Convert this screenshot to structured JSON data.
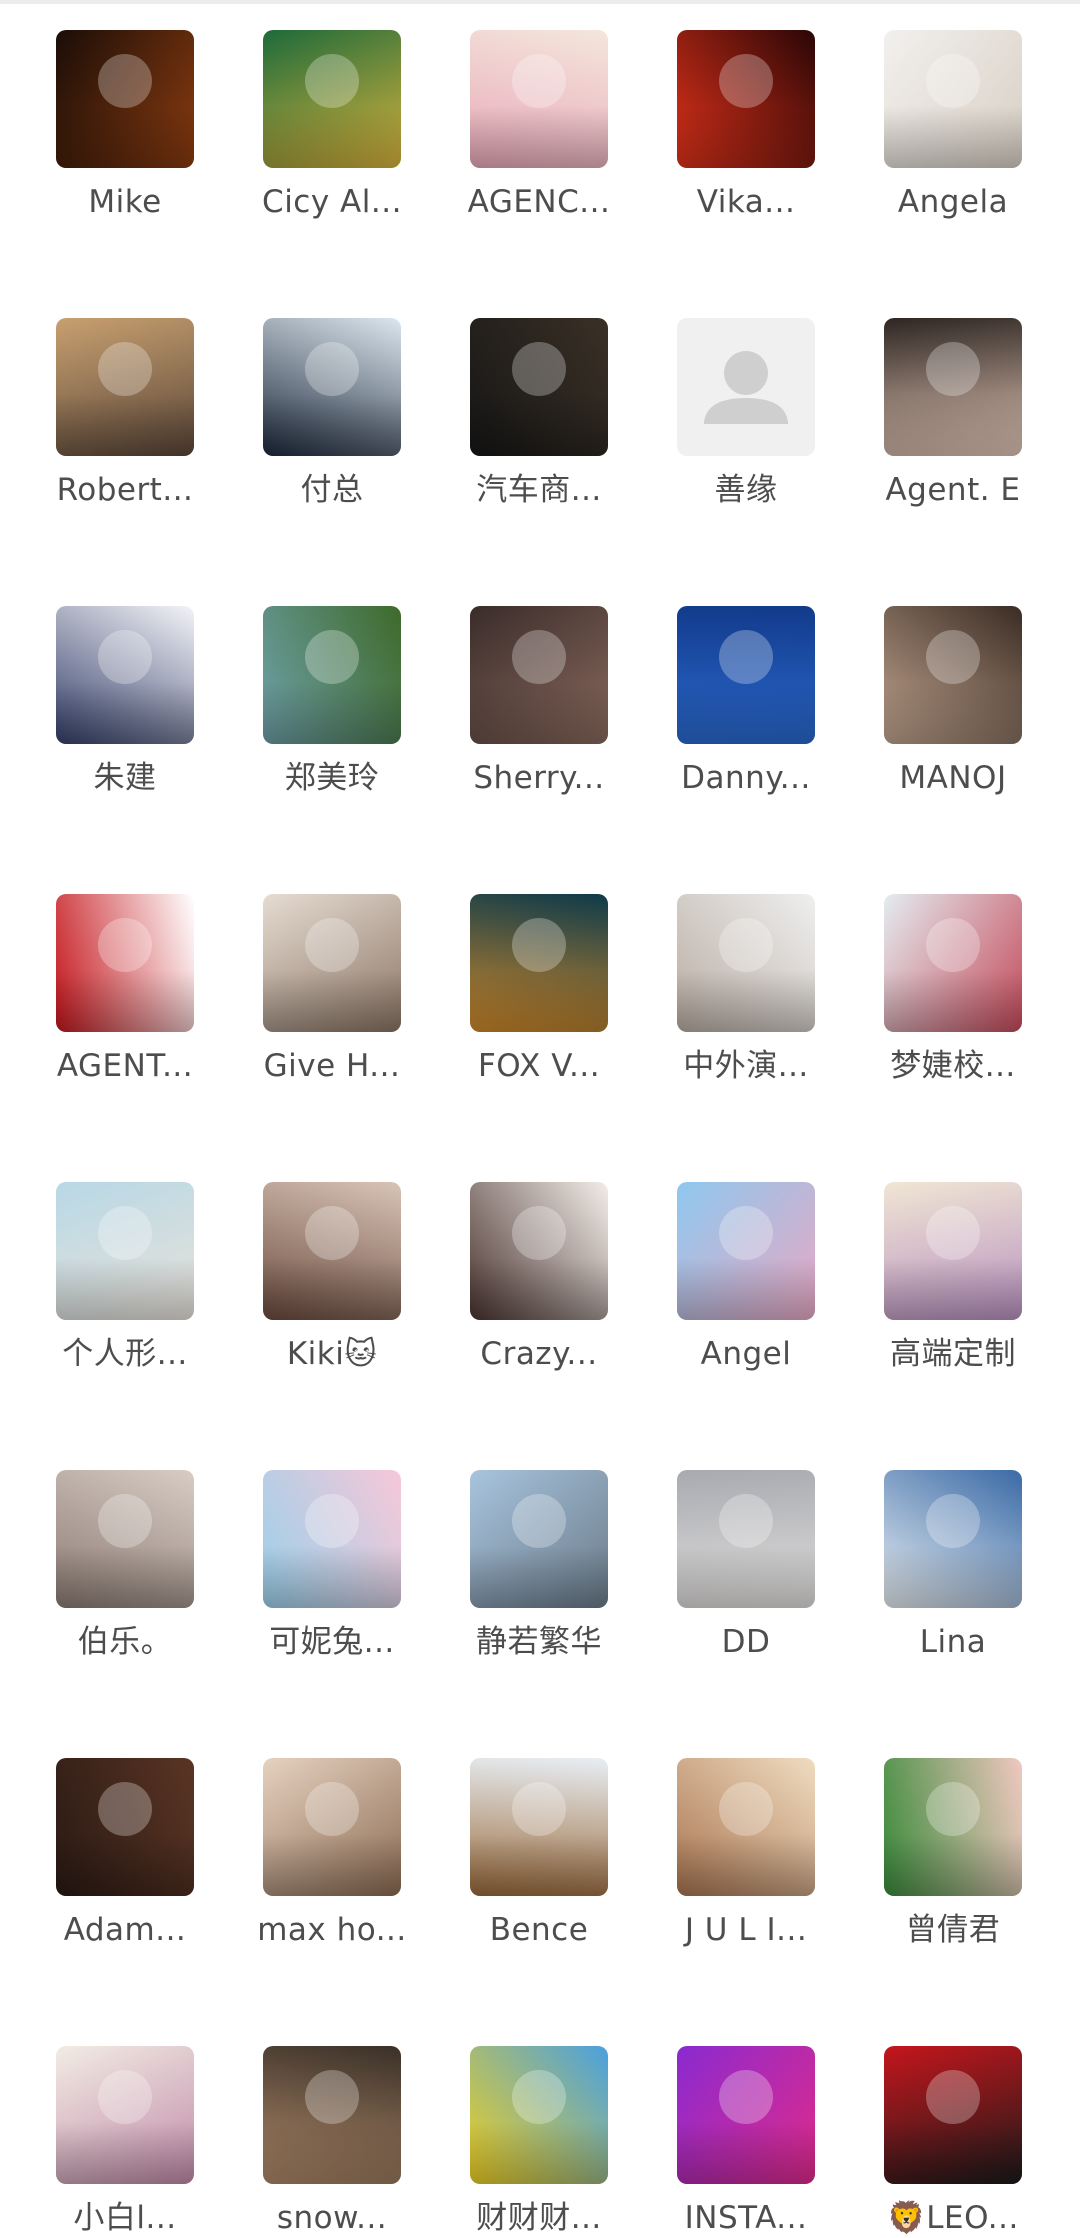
{
  "members": [
    {
      "name": "Mike",
      "icon": "photo",
      "colors": [
        "#1a0d07",
        "#8a3b10"
      ]
    },
    {
      "name": "Cicy Al...",
      "icon": "photo",
      "colors": [
        "#1d6a3a",
        "#d9b43c"
      ]
    },
    {
      "name": "AGENC...",
      "icon": "photo",
      "colors": [
        "#f4e6dc",
        "#e8a8b8"
      ]
    },
    {
      "name": "Vika...",
      "icon": "photo",
      "colors": [
        "#2a0606",
        "#e2321a"
      ]
    },
    {
      "name": "Angela",
      "icon": "photo",
      "colors": [
        "#f2f0ee",
        "#d8cfc4"
      ]
    },
    {
      "name": "Robert...",
      "icon": "photo",
      "colors": [
        "#c8a070",
        "#5a4638"
      ]
    },
    {
      "name": "付总",
      "icon": "photo",
      "colors": [
        "#dbe6ee",
        "#1e2a3c"
      ]
    },
    {
      "name": "汽车商...",
      "icon": "photo",
      "colors": [
        "#3a3026",
        "#161616"
      ]
    },
    {
      "name": "善缘",
      "icon": "default-person",
      "colors": [
        "#f0f0f0",
        "#e9e9e9"
      ]
    },
    {
      "name": "Agent. E",
      "icon": "photo",
      "colors": [
        "#2e2622",
        "#e4c8b8"
      ]
    },
    {
      "name": "朱建",
      "icon": "photo",
      "colors": [
        "#f4f4f8",
        "#35406a"
      ]
    },
    {
      "name": "郑美玲",
      "icon": "photo",
      "colors": [
        "#3e6a2a",
        "#6ea0a8"
      ]
    },
    {
      "name": "Sherry...",
      "icon": "photo",
      "colors": [
        "#3a2c2a",
        "#8a6a5e"
      ]
    },
    {
      "name": "Danny...",
      "icon": "photo",
      "colors": [
        "#123a8a",
        "#2a6ad0"
      ]
    },
    {
      "name": "MANOJ",
      "icon": "photo",
      "colors": [
        "#3a2c24",
        "#c4a690"
      ]
    },
    {
      "name": "AGENT...",
      "icon": "photo",
      "colors": [
        "#ffffff",
        "#c4161c"
      ]
    },
    {
      "name": "Give H...",
      "icon": "photo",
      "colors": [
        "#e6dcd2",
        "#8a7464"
      ]
    },
    {
      "name": "FOX V...",
      "icon": "photo",
      "colors": [
        "#0e3a4a",
        "#d08a2a"
      ]
    },
    {
      "name": "中外演...",
      "icon": "photo",
      "colors": [
        "#efefef",
        "#b8aca2"
      ]
    },
    {
      "name": "梦婕校...",
      "icon": "photo",
      "colors": [
        "#e4ecf0",
        "#c44a5a"
      ]
    },
    {
      "name": "个人形...",
      "icon": "photo",
      "colors": [
        "#b8d8e6",
        "#e8e2da"
      ]
    },
    {
      "name": "Kiki🐱",
      "icon": "photo",
      "colors": [
        "#d8c4b6",
        "#6a4a3e"
      ]
    },
    {
      "name": "Crazy...",
      "icon": "photo",
      "colors": [
        "#f2ede8",
        "#4a3430"
      ]
    },
    {
      "name": "Angel",
      "icon": "photo",
      "colors": [
        "#8ec8ee",
        "#e8a8c4"
      ]
    },
    {
      "name": "高端定制",
      "icon": "photo",
      "colors": [
        "#f0e6d4",
        "#b890c0"
      ]
    },
    {
      "name": "伯乐。",
      "icon": "photo",
      "colors": [
        "#d8ccc4",
        "#8a7a72"
      ]
    },
    {
      "name": "可妮兔...",
      "icon": "photo",
      "colors": [
        "#f6c8d8",
        "#9ad0ea"
      ]
    },
    {
      "name": "静若繁华",
      "icon": "photo",
      "colors": [
        "#a8c4de",
        "#6a7a88"
      ]
    },
    {
      "name": "DD",
      "icon": "photo",
      "colors": [
        "#a8aab0",
        "#e2e0de"
      ]
    },
    {
      "name": "Lina",
      "icon": "photo",
      "colors": [
        "#3a6aa6",
        "#e8eef2"
      ]
    },
    {
      "name": "Adam...",
      "icon": "photo",
      "colors": [
        "#5a3424",
        "#2a1a14"
      ]
    },
    {
      "name": "max ho...",
      "icon": "photo",
      "colors": [
        "#e6d2c0",
        "#8a6a52"
      ]
    },
    {
      "name": "Bence",
      "icon": "photo",
      "colors": [
        "#e8eef4",
        "#9a6a3a"
      ]
    },
    {
      "name": "J U L I...",
      "icon": "photo",
      "colors": [
        "#f0dcc0",
        "#a87450"
      ]
    },
    {
      "name": "曾倩君",
      "icon": "photo",
      "colors": [
        "#f0c8c0",
        "#3a8a3a"
      ]
    },
    {
      "name": "小白l...",
      "icon": "photo",
      "colors": [
        "#f2ece4",
        "#c08aa8"
      ]
    },
    {
      "name": "snow...",
      "icon": "photo",
      "colors": [
        "#3a3028",
        "#b08a6a"
      ]
    },
    {
      "name": "财财财...",
      "icon": "photo",
      "colors": [
        "#4aa0e0",
        "#f0d020"
      ]
    },
    {
      "name": "INSTA...",
      "icon": "photo",
      "colors": [
        "#8a2ad0",
        "#e02a8a"
      ]
    },
    {
      "name": "🦁LEO...",
      "icon": "photo",
      "colors": [
        "#c4161c",
        "#1a1a1a"
      ]
    }
  ]
}
